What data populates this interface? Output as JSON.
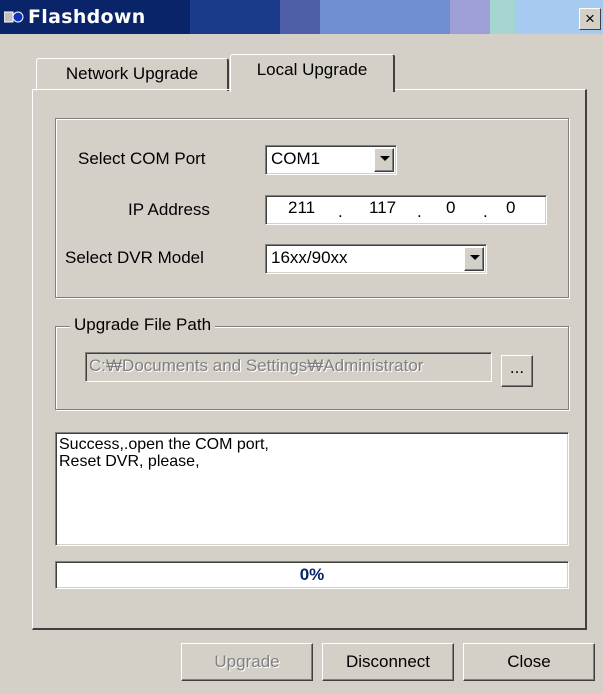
{
  "window": {
    "title": "Flashdown",
    "close_glyph": "×",
    "icon": "app-icon"
  },
  "tabs": [
    {
      "label": "Network Upgrade",
      "selected": false
    },
    {
      "label": "Local Upgrade",
      "selected": true
    }
  ],
  "connection": {
    "com_port_label": "Select COM Port",
    "com_port_value": "COM1",
    "ip_label": "IP Address",
    "ip_octets": [
      "211",
      "117",
      "0",
      "0"
    ],
    "ip_dot": ".",
    "dvr_label": "Select DVR Model",
    "dvr_value": "16xx/90xx"
  },
  "upgrade_file": {
    "legend": "Upgrade File Path",
    "path": "C:₩Documents and Settings₩Administrator",
    "browse_label": "..."
  },
  "log": {
    "lines": [
      "Success,.open the COM port,",
      "Reset DVR, please,"
    ]
  },
  "progress": {
    "value": 0,
    "label": "0%"
  },
  "buttons": {
    "upgrade": "Upgrade",
    "disconnect": "Disconnect",
    "close": "Close"
  },
  "colors": {
    "title_bar": "#0a246a",
    "window_bg": "#d4d0c8",
    "progress_text": "#0a246a"
  }
}
